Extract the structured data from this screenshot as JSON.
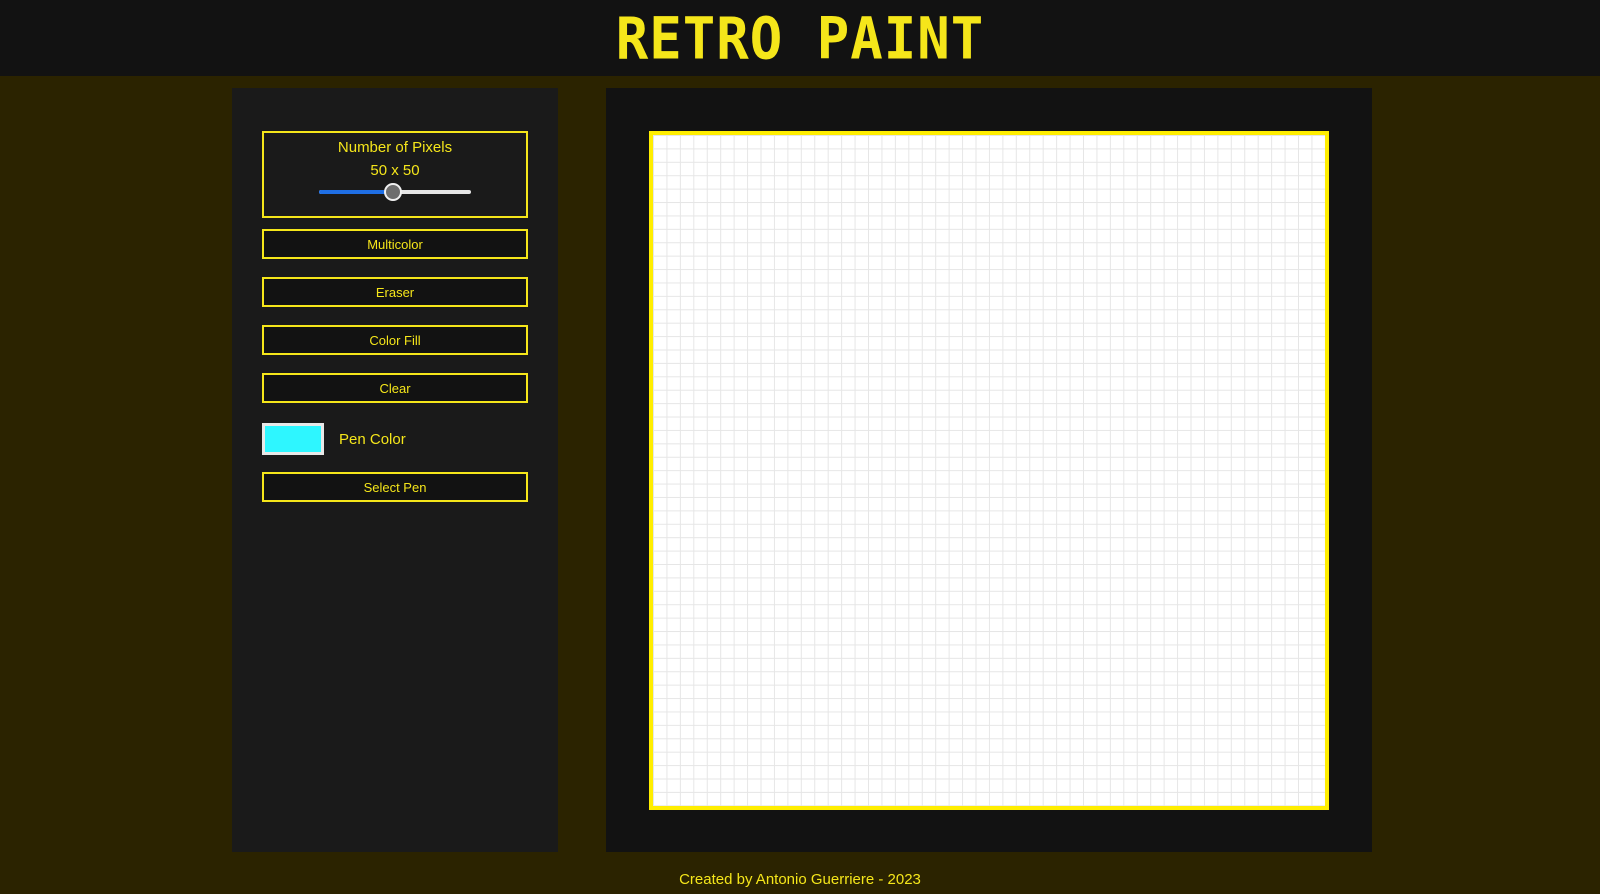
{
  "header": {
    "title": "RETRO PAINT"
  },
  "controls": {
    "pixels": {
      "label": "Number of Pixels",
      "value_text": "50 x 50",
      "slider_fraction": 0.49
    },
    "buttons": {
      "multicolor": "Multicolor",
      "eraser": "Eraser",
      "color_fill": "Color Fill",
      "clear": "Clear",
      "select_pen": "Select Pen"
    },
    "pen": {
      "label": "Pen Color",
      "color": "#2ef6ff"
    }
  },
  "canvas": {
    "grid_size": 50
  },
  "footer": {
    "text": "Created by Antonio Guerriere - 2023"
  },
  "colors": {
    "accent": "#f5e61a",
    "background": "#2b2300",
    "panel": "#1a1a1a",
    "header": "#121212",
    "slider_fill": "#1f6fe5"
  }
}
